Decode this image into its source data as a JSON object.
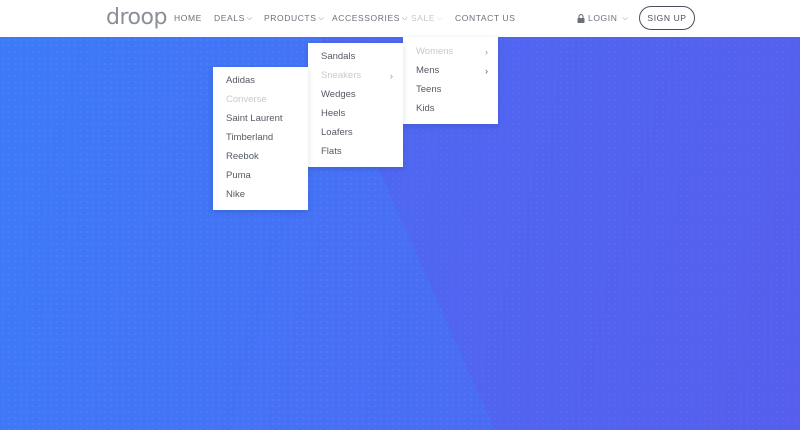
{
  "brand": {
    "logo_text": "droop"
  },
  "nav": {
    "items": [
      {
        "label": "HOME",
        "has_dropdown": false
      },
      {
        "label": "DEALS",
        "has_dropdown": true
      },
      {
        "label": "PRODUCTS",
        "has_dropdown": true
      },
      {
        "label": "ACCESSORIES",
        "has_dropdown": true
      },
      {
        "label": "SALE",
        "has_dropdown": true,
        "state": "hovered"
      },
      {
        "label": "CONTACT US",
        "has_dropdown": false
      }
    ],
    "login_label": "LOGIN",
    "login_icon": "lock-icon",
    "signup_label": "SIGN UP"
  },
  "menus": {
    "sale": {
      "items": [
        {
          "label": "Womens",
          "has_submenu": true,
          "state": "hovered"
        },
        {
          "label": "Mens",
          "has_submenu": true
        },
        {
          "label": "Teens",
          "has_submenu": false
        },
        {
          "label": "Kids",
          "has_submenu": false
        }
      ]
    },
    "womens": {
      "items": [
        {
          "label": "Sandals",
          "has_submenu": false
        },
        {
          "label": "Sneakers",
          "has_submenu": true,
          "state": "hovered"
        },
        {
          "label": "Wedges",
          "has_submenu": false
        },
        {
          "label": "Heels",
          "has_submenu": false
        },
        {
          "label": "Loafers",
          "has_submenu": false
        },
        {
          "label": "Flats",
          "has_submenu": false
        }
      ]
    },
    "sneakers": {
      "items": [
        {
          "label": "Adidas"
        },
        {
          "label": "Converse",
          "state": "hovered"
        },
        {
          "label": "Saint Laurent"
        },
        {
          "label": "Timberland"
        },
        {
          "label": "Reebok"
        },
        {
          "label": "Puma"
        },
        {
          "label": "Nike"
        }
      ]
    }
  },
  "colors": {
    "hero_start": "#3d7af8",
    "hero_end": "#5560ee",
    "text": "#6b7079",
    "faded": "#c4c8ce"
  }
}
